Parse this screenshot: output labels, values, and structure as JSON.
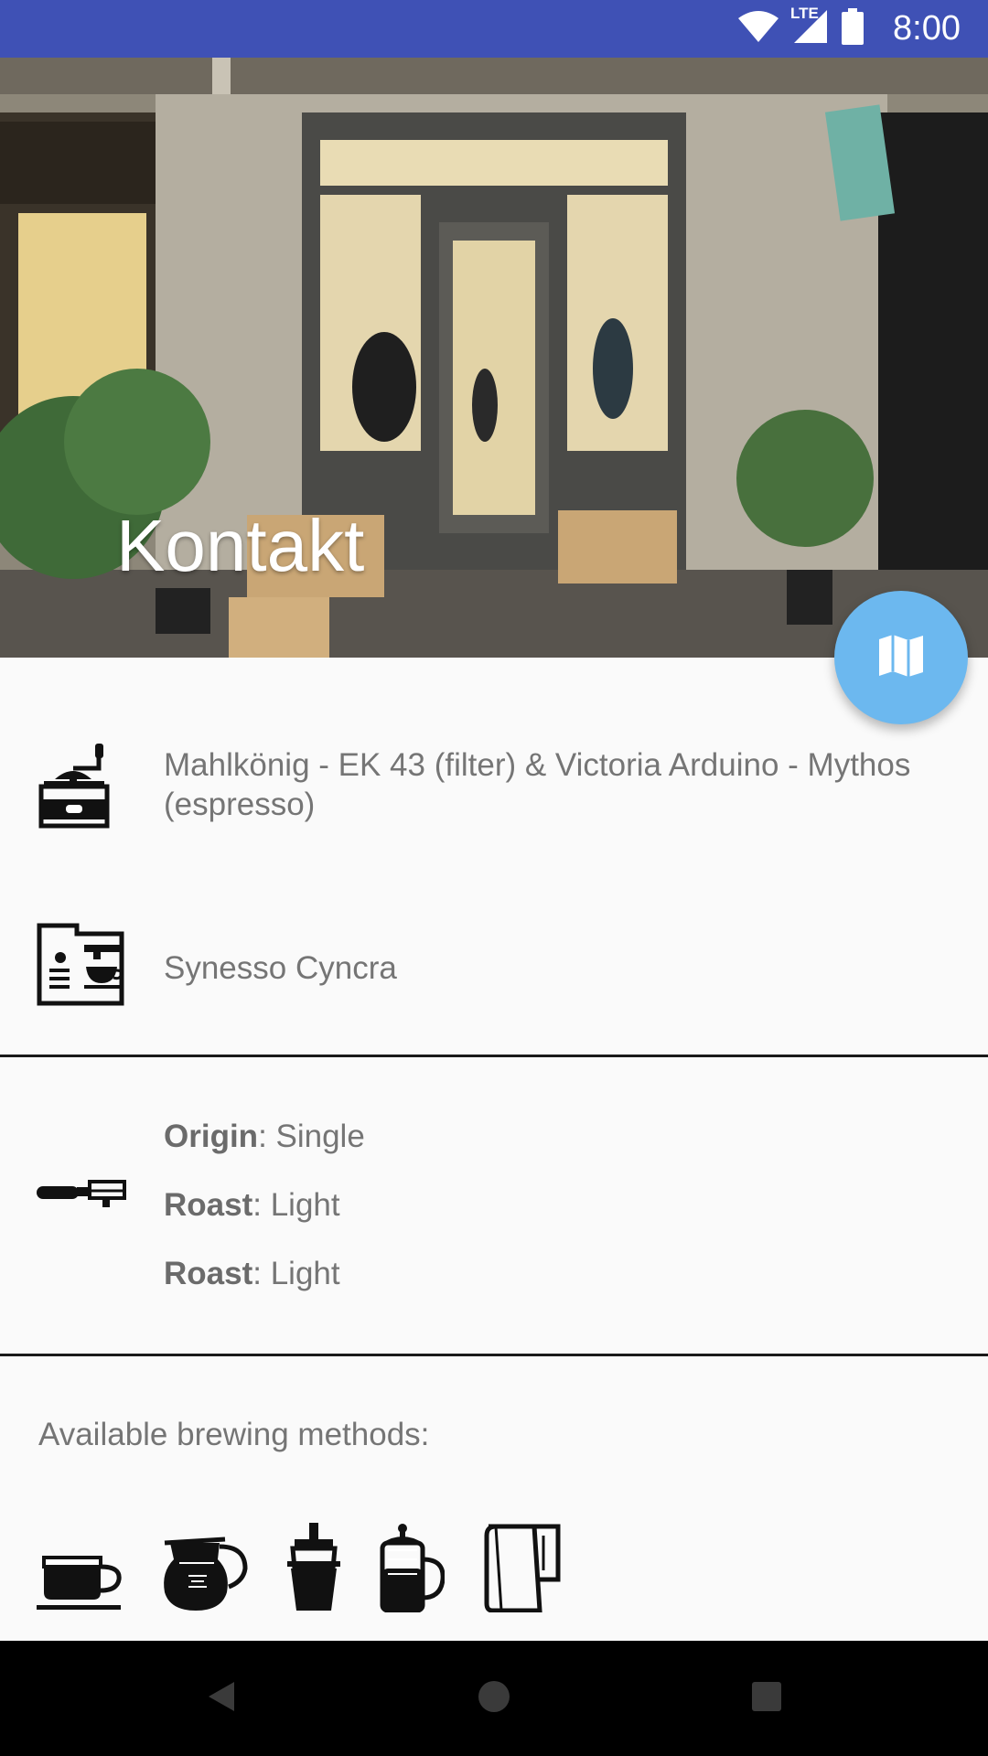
{
  "status_bar": {
    "time": "8:00",
    "network_label": "LTE",
    "icons": [
      "wifi-icon",
      "cell-signal-icon",
      "battery-icon"
    ]
  },
  "header": {
    "title": "Kontakt",
    "fab_icon": "map-icon"
  },
  "info": {
    "grinder": {
      "icon": "coffee-grinder-icon",
      "text": "Mahlkönig - EK 43 (filter) & Victoria Arduino - Mythos (espresso)"
    },
    "machine": {
      "icon": "espresso-machine-icon",
      "text": "Synesso Cyncra"
    }
  },
  "beans": {
    "icon": "portafilter-icon",
    "items": [
      {
        "label": "Origin",
        "value": ": Single"
      },
      {
        "label": "Roast",
        "value": ": Light"
      },
      {
        "label": "Roast",
        "value": ": Light"
      }
    ]
  },
  "brewing": {
    "title": "Available brewing methods:",
    "methods": [
      "cup-icon",
      "coffee-pot-icon",
      "aeropress-icon",
      "french-press-icon",
      "pour-over-kettle-icon"
    ]
  },
  "colors": {
    "status_bar": "#3f51b5",
    "fab": "#6cb8ef",
    "background": "#fafafa",
    "text": "#757575"
  }
}
